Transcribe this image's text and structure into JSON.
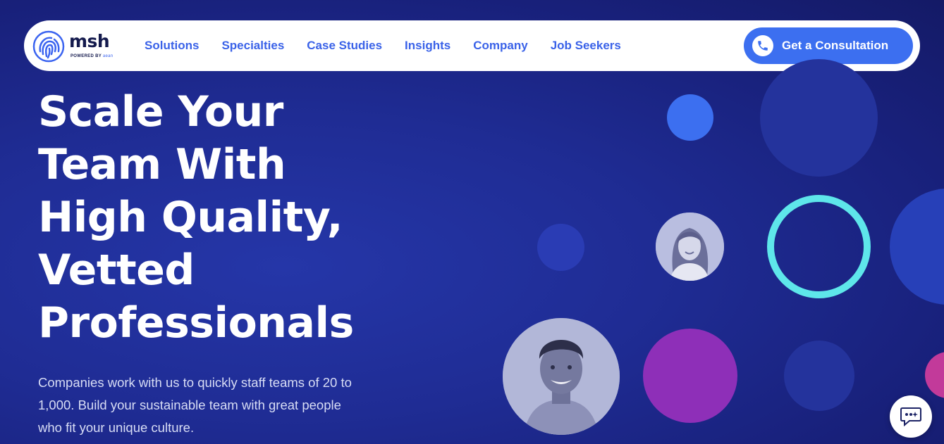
{
  "nav": {
    "logo": {
      "name": "msh",
      "sub_prefix": "POWERED BY",
      "sub_brand": "aean"
    },
    "items": [
      {
        "label": "Solutions"
      },
      {
        "label": "Specialties"
      },
      {
        "label": "Case Studies"
      },
      {
        "label": "Insights"
      },
      {
        "label": "Company"
      },
      {
        "label": "Job Seekers"
      }
    ],
    "cta": {
      "label": "Get a Consultation",
      "icon": "phone-icon"
    }
  },
  "hero": {
    "headline_lines": [
      "Scale Your",
      "Team With",
      "High Quality,",
      "Vetted",
      "Professionals"
    ],
    "subtext": "Companies work with us to quickly staff teams of 20 to 1,000. Build your sustainable team with great people who fit your unique culture."
  },
  "decor": {
    "colors": {
      "background": "#1f2c94",
      "accent_blue": "#3c6ff0",
      "dark_blue": "#2a3aa8",
      "teal_ring": "#5ee6ea",
      "purple": "#8e2fb8",
      "magenta": "#c23a9a"
    }
  },
  "chat_widget": {
    "icon": "chat-bubble-icon"
  }
}
